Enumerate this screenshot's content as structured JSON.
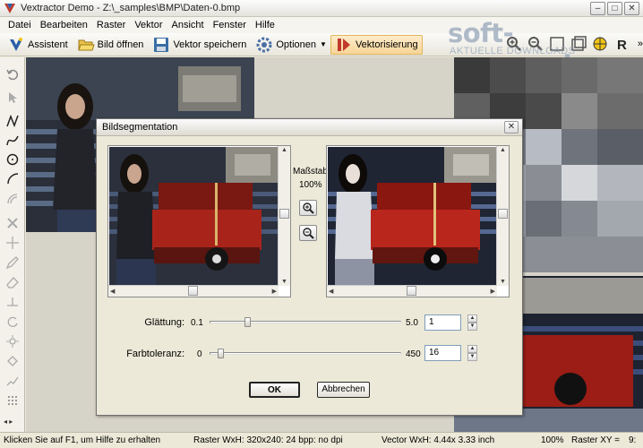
{
  "window": {
    "title": "Vextractor Demo - Z:\\_samples\\BMP\\Daten-0.bmp"
  },
  "menu": [
    "Datei",
    "Bearbeiten",
    "Raster",
    "Vektor",
    "Ansicht",
    "Fenster",
    "Hilfe"
  ],
  "toolbar": {
    "assistant_label": "Assistent",
    "open_label": "Bild öffnen",
    "save_label": "Vektor speichern",
    "options_label": "Optionen",
    "vectorize_label": "Vektorisierung"
  },
  "watermark": {
    "main": "soft-ware.net",
    "sub": "AKTUELLE DOWNLOADS"
  },
  "dialog": {
    "title": "Bildsegmentation",
    "scale_label": "Maßstab:",
    "scale_value": "100%",
    "smoothing": {
      "label": "Glättung:",
      "min": "0.1",
      "max": "5.0",
      "value": "1",
      "position": 0.18
    },
    "color_tolerance": {
      "label": "Farbtoleranz:",
      "min": "0",
      "max": "450",
      "value": "16",
      "position": 0.04
    },
    "ok_label": "OK",
    "cancel_label": "Abbrechen"
  },
  "statusbar": {
    "hint": "Klicken Sie auf F1, um Hilfe zu erhalten",
    "raster_info": "Raster WxH: 320x240: 24 bpp: no dpi",
    "vector_info": "Vector WxH:  4.44x 3.33 inch",
    "zoom": "100%",
    "raster_xy": "Raster XY =",
    "raster_xy_value": "9:"
  },
  "colors": {
    "accent": "#3a6ea5",
    "sofa_red": "#b0231c",
    "background": "#ece9d8"
  }
}
